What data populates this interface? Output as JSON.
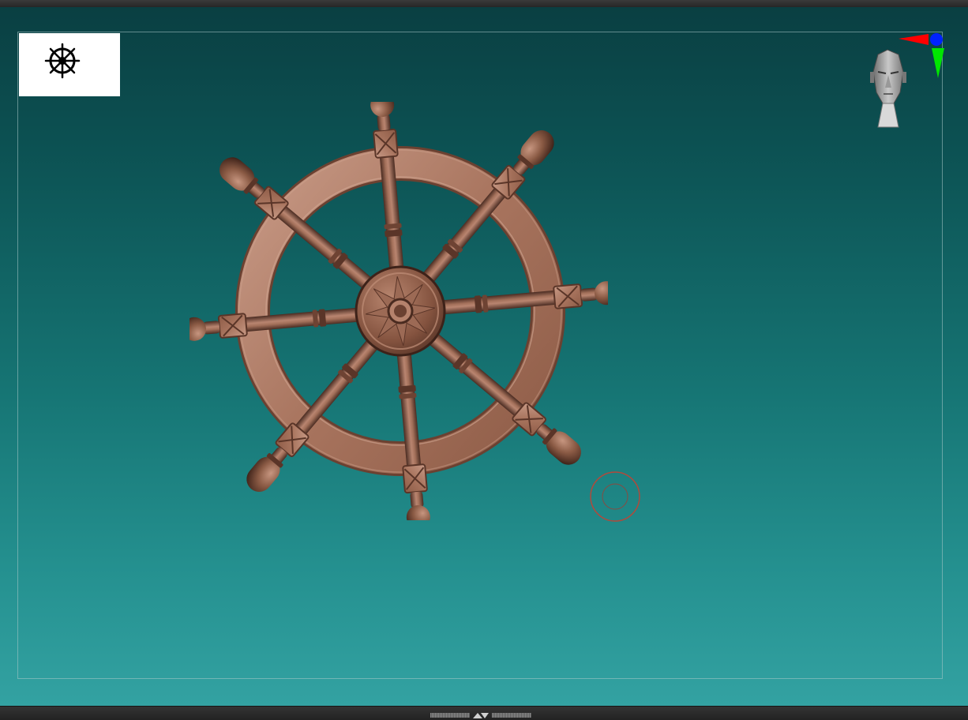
{
  "app": {
    "type": "3d-sculpting-viewport"
  },
  "canvas": {
    "background_top": "#0a3f42",
    "background_bottom": "#33a2a2",
    "frame_color": "#a9c6c6"
  },
  "thumbnail": {
    "icon": "ship-wheel-icon",
    "background": "#ffffff"
  },
  "model": {
    "icon": "ship-wheel-model",
    "material_color": "#8a5a44"
  },
  "navigation": {
    "orientation_head_icon": "head-gizmo-icon",
    "axis_colors": {
      "x": "#ff0000",
      "y": "#00e600",
      "z": "#0022ff"
    }
  },
  "cursor": {
    "icon": "brush-cursor-icon",
    "color": "#b04a3c"
  },
  "tray": {
    "icon": "tray-toggle-arrows-icon"
  }
}
